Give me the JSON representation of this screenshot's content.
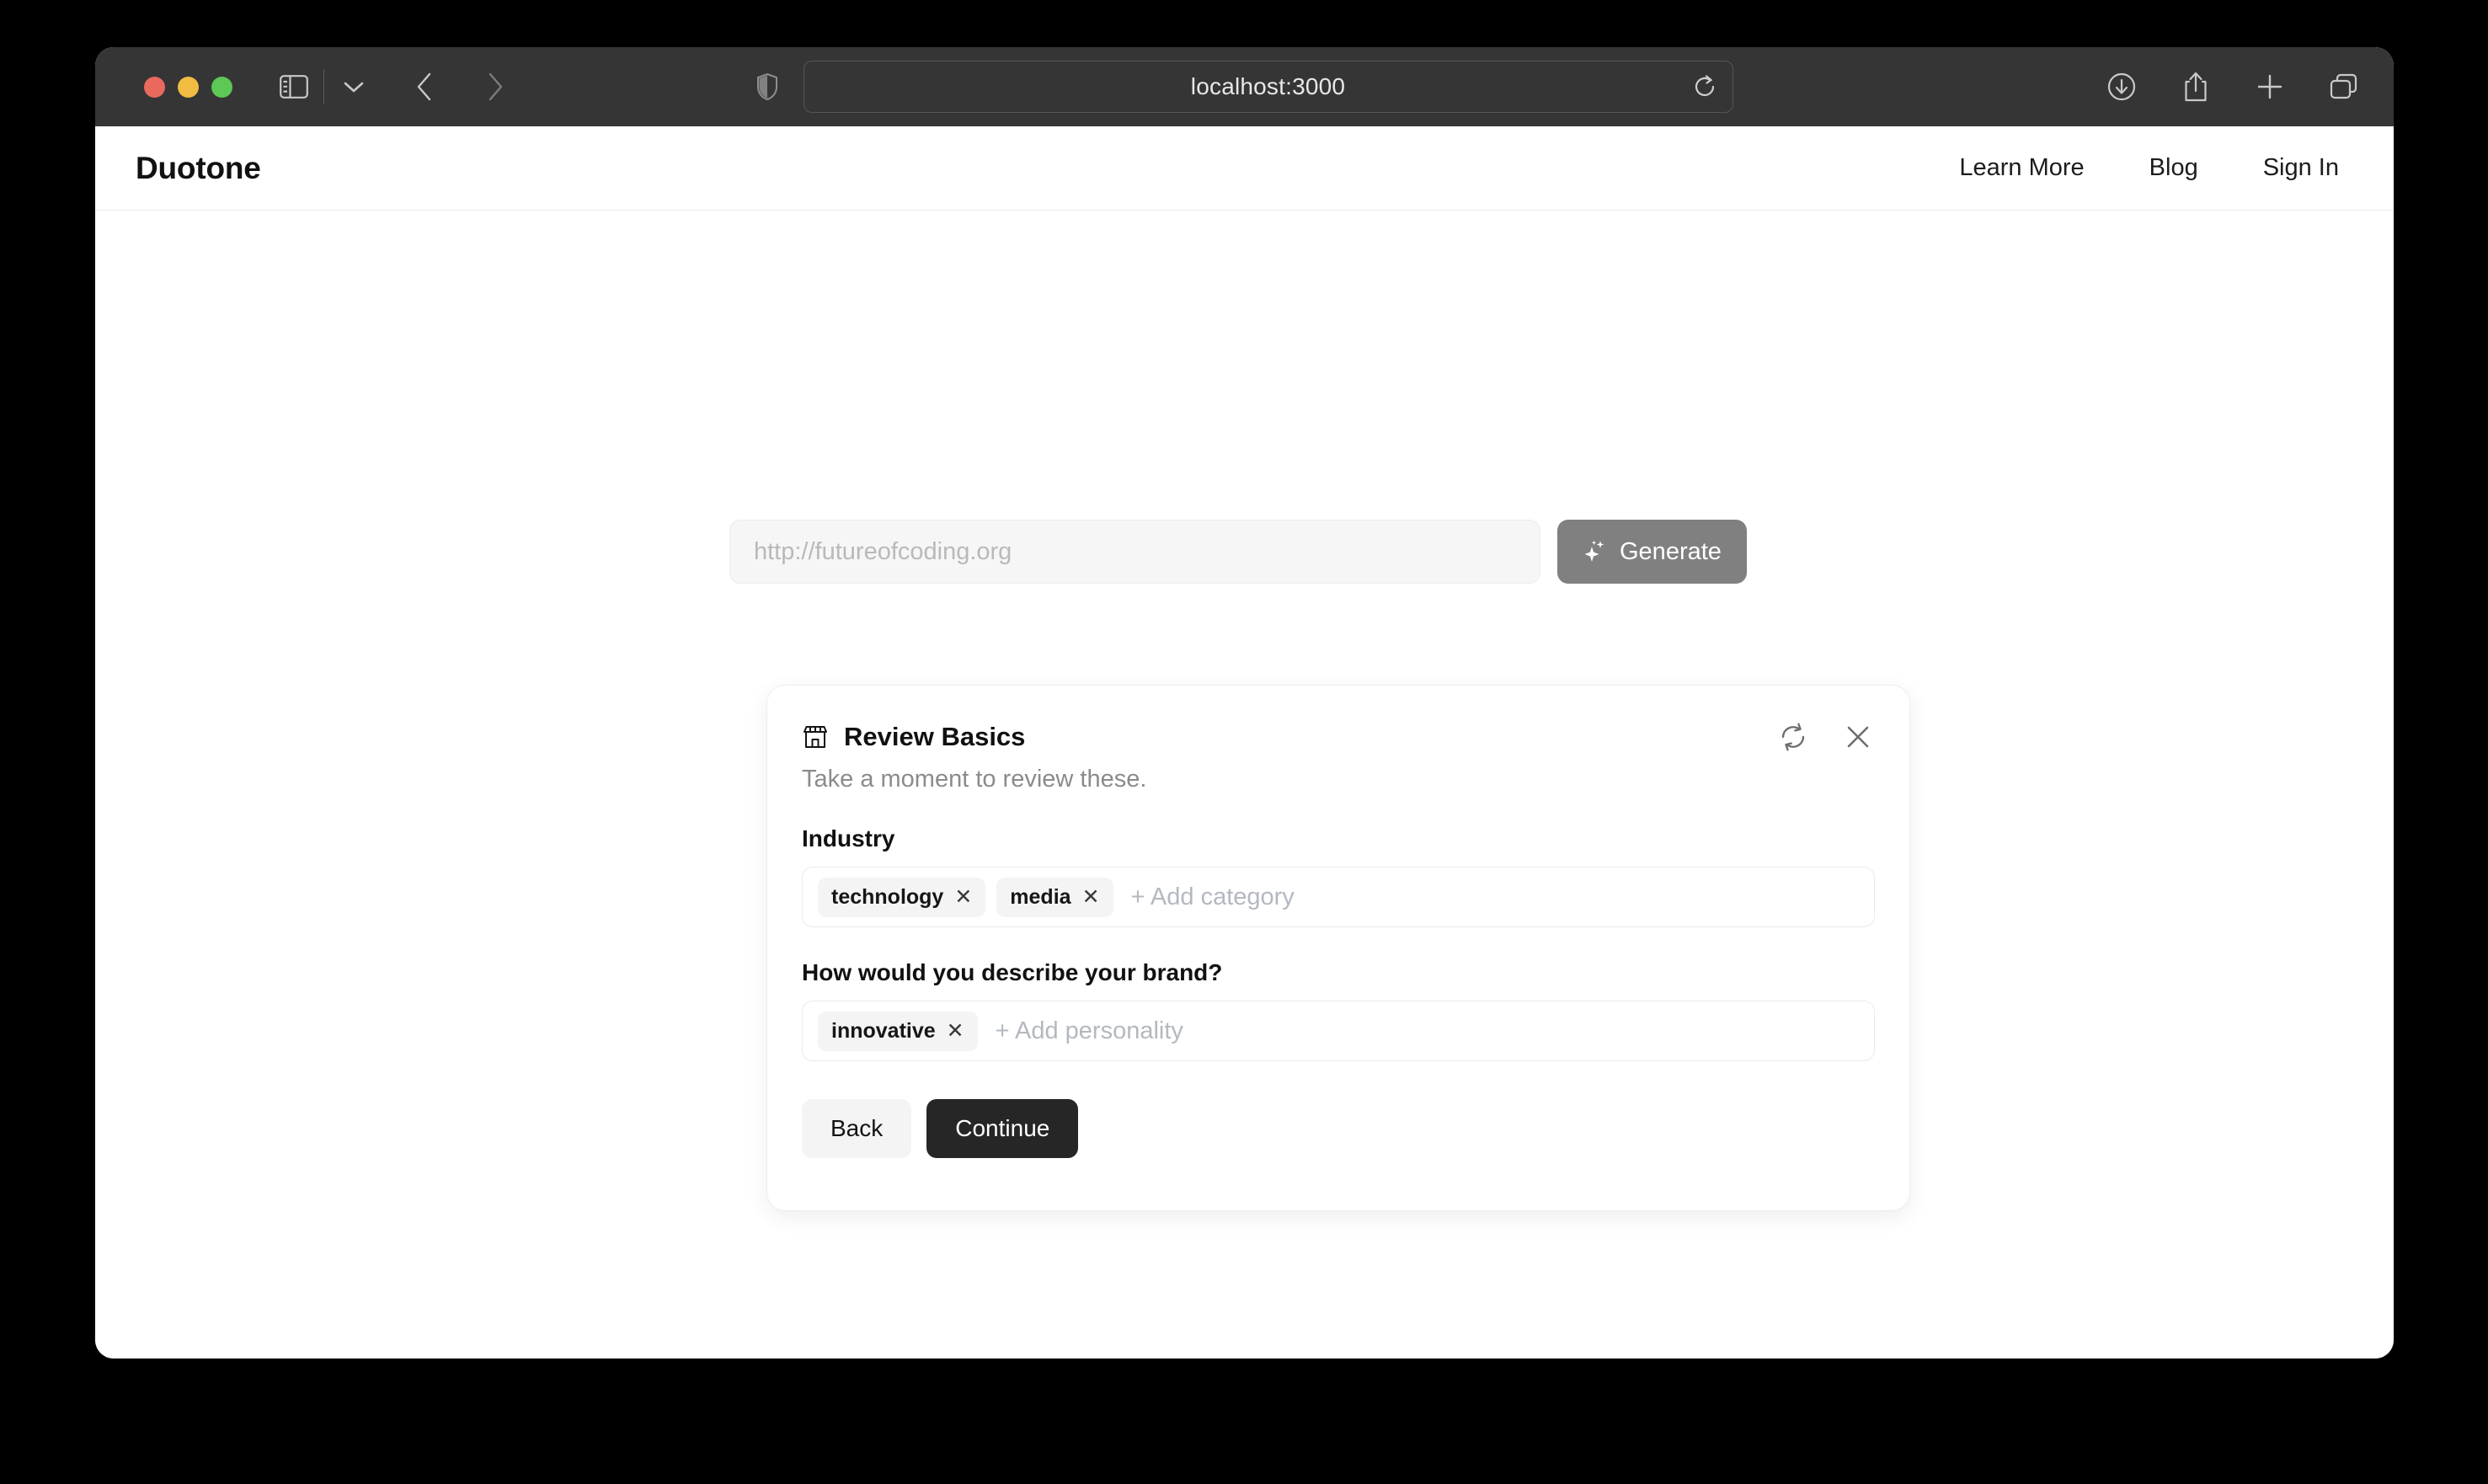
{
  "browser": {
    "url": "localhost:3000",
    "traffic_lights": [
      "close",
      "minimize",
      "maximize"
    ],
    "toolbar_left": [
      {
        "icon": "sidebar-icon"
      },
      {
        "icon": "chevron-down-icon"
      },
      {
        "icon": "back-arrow-icon"
      },
      {
        "icon": "forward-arrow-icon"
      }
    ],
    "toolbar_right": [
      {
        "icon": "downloads-icon"
      },
      {
        "icon": "share-icon"
      },
      {
        "icon": "new-tab-icon"
      },
      {
        "icon": "tab-overview-icon"
      }
    ],
    "shield_icon": "privacy-shield-icon",
    "reload_icon": "reload-icon"
  },
  "site": {
    "brand": "Duotone",
    "nav": [
      {
        "label": "Learn More"
      },
      {
        "label": "Blog"
      },
      {
        "label": "Sign In"
      }
    ]
  },
  "generator": {
    "url_placeholder": "http://futureofcoding.org",
    "url_value": "",
    "generate_label": "Generate",
    "generate_icon": "sparkles-icon",
    "generate_color": "#808080"
  },
  "card": {
    "icon": "storefront-icon",
    "title": "Review Basics",
    "subtitle": "Take a moment to review these.",
    "actions": [
      {
        "icon": "refresh-icon",
        "name": "regenerate"
      },
      {
        "icon": "close-icon",
        "name": "close"
      }
    ],
    "fields": [
      {
        "label": "Industry",
        "placeholder": "+ Add category",
        "tags": [
          "technology",
          "media"
        ]
      },
      {
        "label": "How would you describe your brand?",
        "placeholder": "+ Add personality",
        "tags": [
          "innovative"
        ]
      }
    ],
    "footer": {
      "back_label": "Back",
      "continue_label": "Continue",
      "continue_color": "#262626"
    }
  }
}
